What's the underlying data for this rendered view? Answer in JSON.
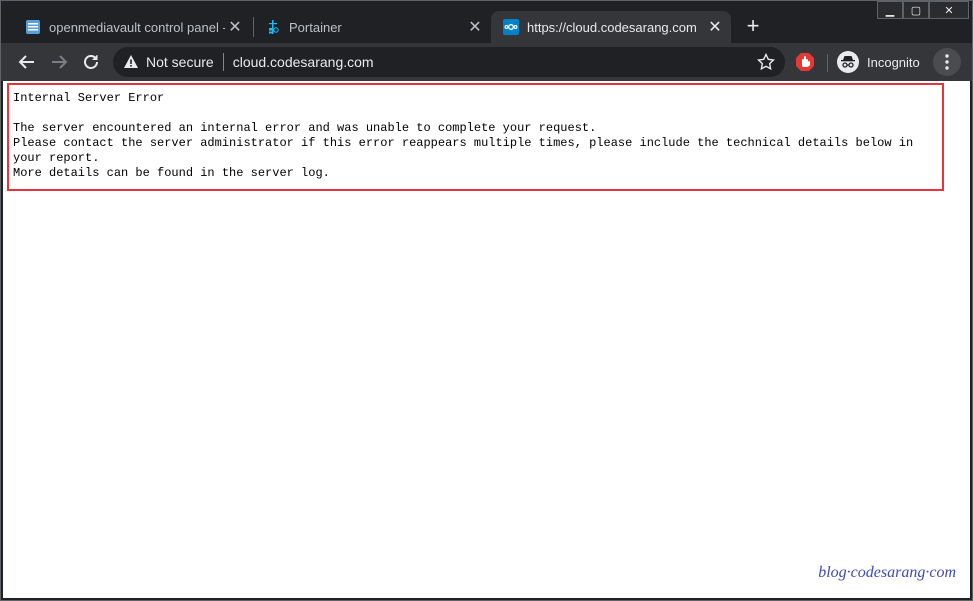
{
  "tabs": [
    {
      "title": "openmediavault control panel - o",
      "favicon": "openmediavault-icon",
      "active": false
    },
    {
      "title": "Portainer",
      "favicon": "portainer-icon",
      "active": false
    },
    {
      "title": "https://cloud.codesarang.com",
      "favicon": "nextcloud-icon",
      "active": true
    }
  ],
  "toolbar": {
    "security_label": "Not secure",
    "url": "cloud.codesarang.com",
    "profile_label": "Incognito"
  },
  "page": {
    "heading": "Internal Server Error",
    "paragraph": "The server encountered an internal error and was unable to complete your request.\nPlease contact the server administrator if this error reappears multiple times, please include the technical details below in your report.\nMore details can be found in the server log."
  },
  "watermark": "blog·codesarang·com",
  "colors": {
    "highlight_border": "#e8323c",
    "tab_bg": "#202124",
    "toolbar_bg": "#35363a",
    "watermark": "#3d4bb5"
  }
}
